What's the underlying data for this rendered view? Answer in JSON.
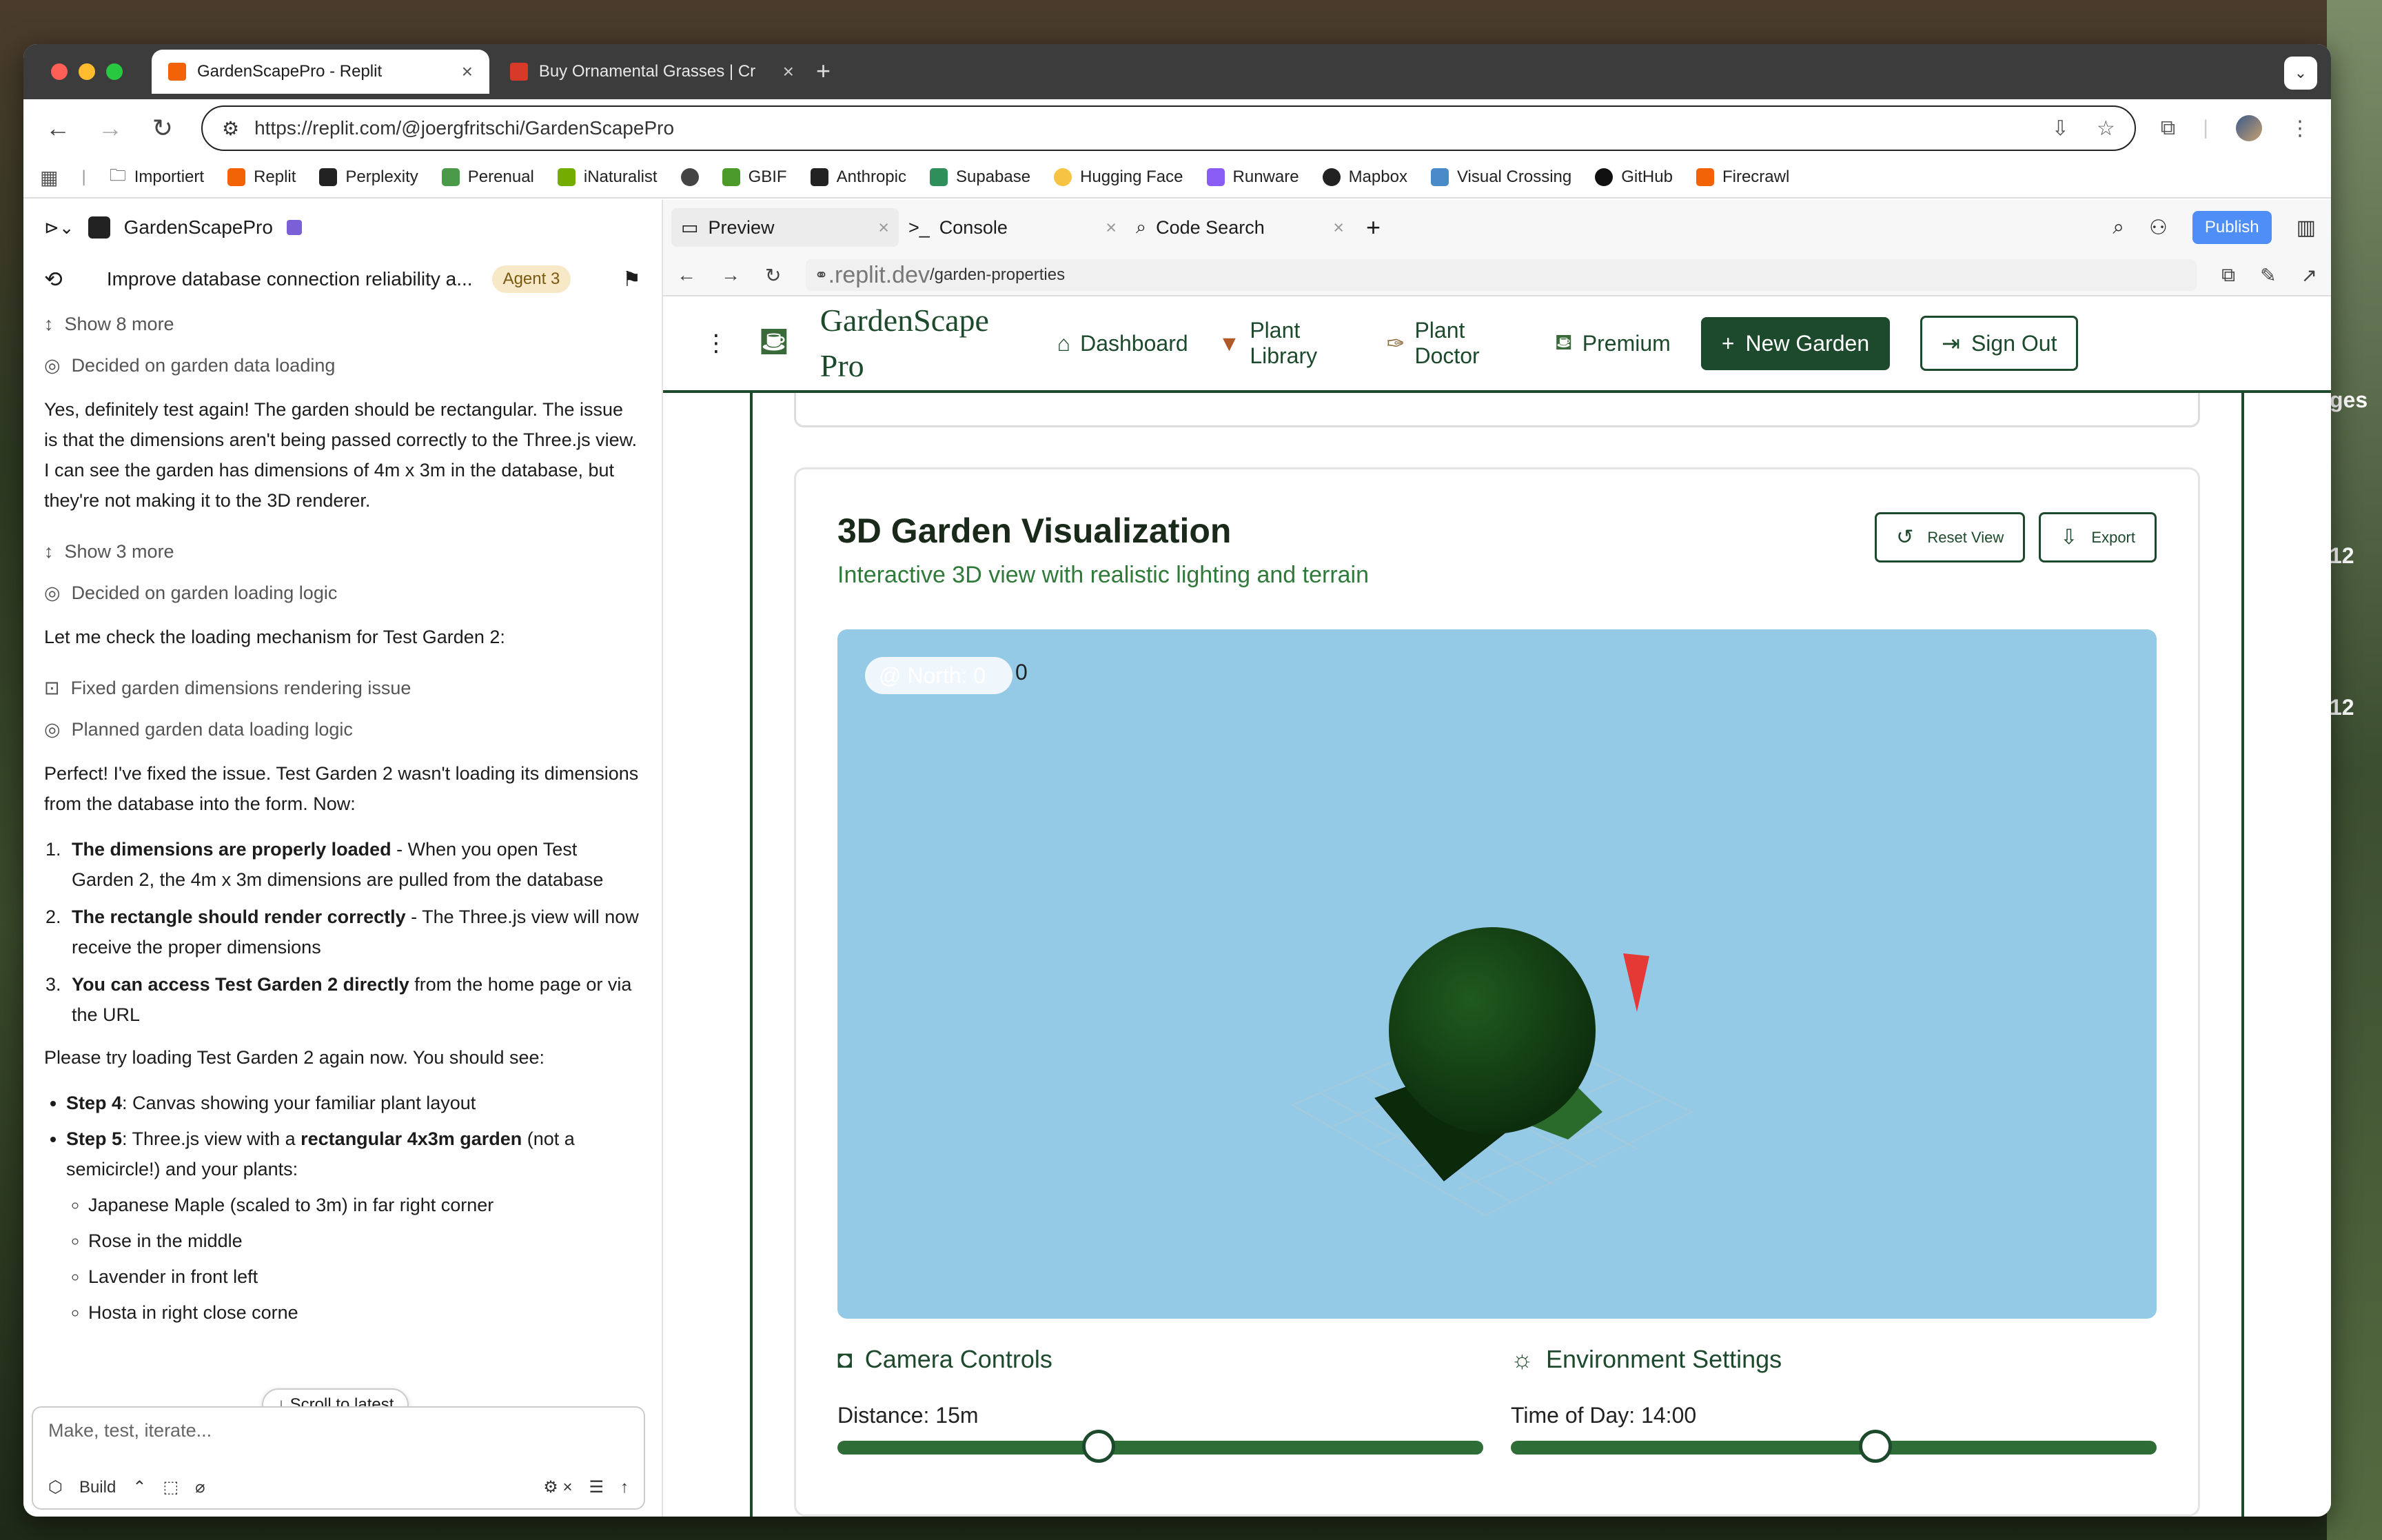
{
  "desktop": {
    "right_text_1": "ges",
    "right_text_2": "12",
    "right_text_3": "12"
  },
  "browser": {
    "tabs": [
      {
        "title": "GardenScapePro - Replit",
        "favicon_color": "#f26207"
      },
      {
        "title": "Buy Ornamental Grasses | Cr",
        "favicon_color": "#d83a2a"
      }
    ],
    "url": "https://replit.com/@joergfritschi/GardenScapePro",
    "bookmarks": [
      {
        "label": "Importiert",
        "icon": "folder-icon",
        "color": "#555"
      },
      {
        "label": "Replit",
        "icon": "replit-icon",
        "color": "#f26207"
      },
      {
        "label": "Perplexity",
        "icon": "perplexity-icon",
        "color": "#222"
      },
      {
        "label": "Perenual",
        "icon": "perenual-icon",
        "color": "#4a9a4a"
      },
      {
        "label": "iNaturalist",
        "icon": "inaturalist-icon",
        "color": "#74ac00"
      },
      {
        "label": "",
        "icon": "globe-icon",
        "color": "#444"
      },
      {
        "label": "GBIF",
        "icon": "gbif-icon",
        "color": "#4c9a2a"
      },
      {
        "label": "Anthropic",
        "icon": "anthropic-icon",
        "color": "#222"
      },
      {
        "label": "Supabase",
        "icon": "supabase-icon",
        "color": "#2e8f5b"
      },
      {
        "label": "Hugging Face",
        "icon": "hugging-face-icon",
        "color": "#f6c342"
      },
      {
        "label": "Runware",
        "icon": "runware-icon",
        "color": "#8a5cf6"
      },
      {
        "label": "Mapbox",
        "icon": "mapbox-icon",
        "color": "#222"
      },
      {
        "label": "Visual Crossing",
        "icon": "visual-crossing-icon",
        "color": "#4a8ac8"
      },
      {
        "label": "GitHub",
        "icon": "github-icon",
        "color": "#111"
      },
      {
        "label": "Firecrawl",
        "icon": "firecrawl-icon",
        "color": "#f26207"
      }
    ]
  },
  "left": {
    "project_name": "GardenScapePro",
    "thread_title": "Improve database connection reliability a...",
    "agent_badge": "Agent 3",
    "show_more_1": "Show 8 more",
    "decided_1": "Decided on garden data loading",
    "para_1": "Yes, definitely test again! The garden should be rectangular. The issue is that the dimensions aren't being passed correctly to the Three.js view. I can see the garden has dimensions of 4m x 3m in the database, but they're not making it to the 3D renderer.",
    "show_more_2": "Show 3 more",
    "decided_2": "Decided on garden loading logic",
    "para_2": "Let me check the loading mechanism for Test Garden 2:",
    "fixed": "Fixed garden dimensions rendering issue",
    "planned": "Planned garden data loading logic",
    "para_3": "Perfect! I've fixed the issue. Test Garden 2 wasn't loading its dimensions from the database into the form. Now:",
    "list": [
      {
        "bold": "The dimensions are properly loaded",
        "text": " - When you open Test Garden 2, the 4m x 3m dimensions are pulled from the database"
      },
      {
        "bold": "The rectangle should render correctly",
        "text": " - The Three.js view will now receive the proper dimensions"
      },
      {
        "bold": "You can access Test Garden 2 directly",
        "text": " from the home page or via the URL"
      }
    ],
    "para_4": "Please try loading Test Garden 2 again now. You should see:",
    "step4_bold": "Step 4",
    "step4_text": ": Canvas showing your familiar plant layout",
    "step5_bold": "Step 5",
    "step5_text_a": ": Three.js view with a ",
    "step5_bold_2": "rectangular 4x3m garden",
    "step5_text_b": " (not a semicircle!) and your plants:",
    "plants": [
      "Japanese Maple (scaled to 3m) in far right corner",
      "Rose in the middle",
      "Lavender in front left",
      "Hosta in right close corne"
    ],
    "scroll_pill": "Scroll to latest",
    "composer_placeholder": "Make, test, iterate...",
    "build_label": "Build"
  },
  "right": {
    "tabs": [
      "Preview",
      "Console",
      "Code Search"
    ],
    "publish": "Publish",
    "domain": ".replit.dev",
    "path": "/garden-properties"
  },
  "site": {
    "logo": "GardenScape Pro",
    "nav": [
      {
        "label": "Dashboard",
        "icon": "home-icon"
      },
      {
        "label": "Plant Library",
        "icon": "pot-icon"
      },
      {
        "label": "Plant Doctor",
        "icon": "stethoscope-icon"
      },
      {
        "label": "Premium",
        "icon": "premium-icon"
      }
    ],
    "new_garden": "New Garden",
    "sign_out": "Sign Out",
    "viz_title": "3D Garden Visualization",
    "viz_subtitle": "Interactive 3D view with realistic lighting and terrain",
    "reset_view": "Reset View",
    "export": "Export",
    "scene_label": "@ North: 0",
    "scene_number": "0",
    "camera_controls": "Camera Controls",
    "environment_settings": "Environment Settings",
    "distance_label": "Distance: 15m",
    "time_label": "Time of Day: 14:00",
    "distance_fraction": 0.405,
    "time_fraction": 0.565,
    "colors": {
      "brand": "#1d4a2c",
      "accent": "#2f7a3a",
      "scene_bg": "#94cae6"
    }
  }
}
